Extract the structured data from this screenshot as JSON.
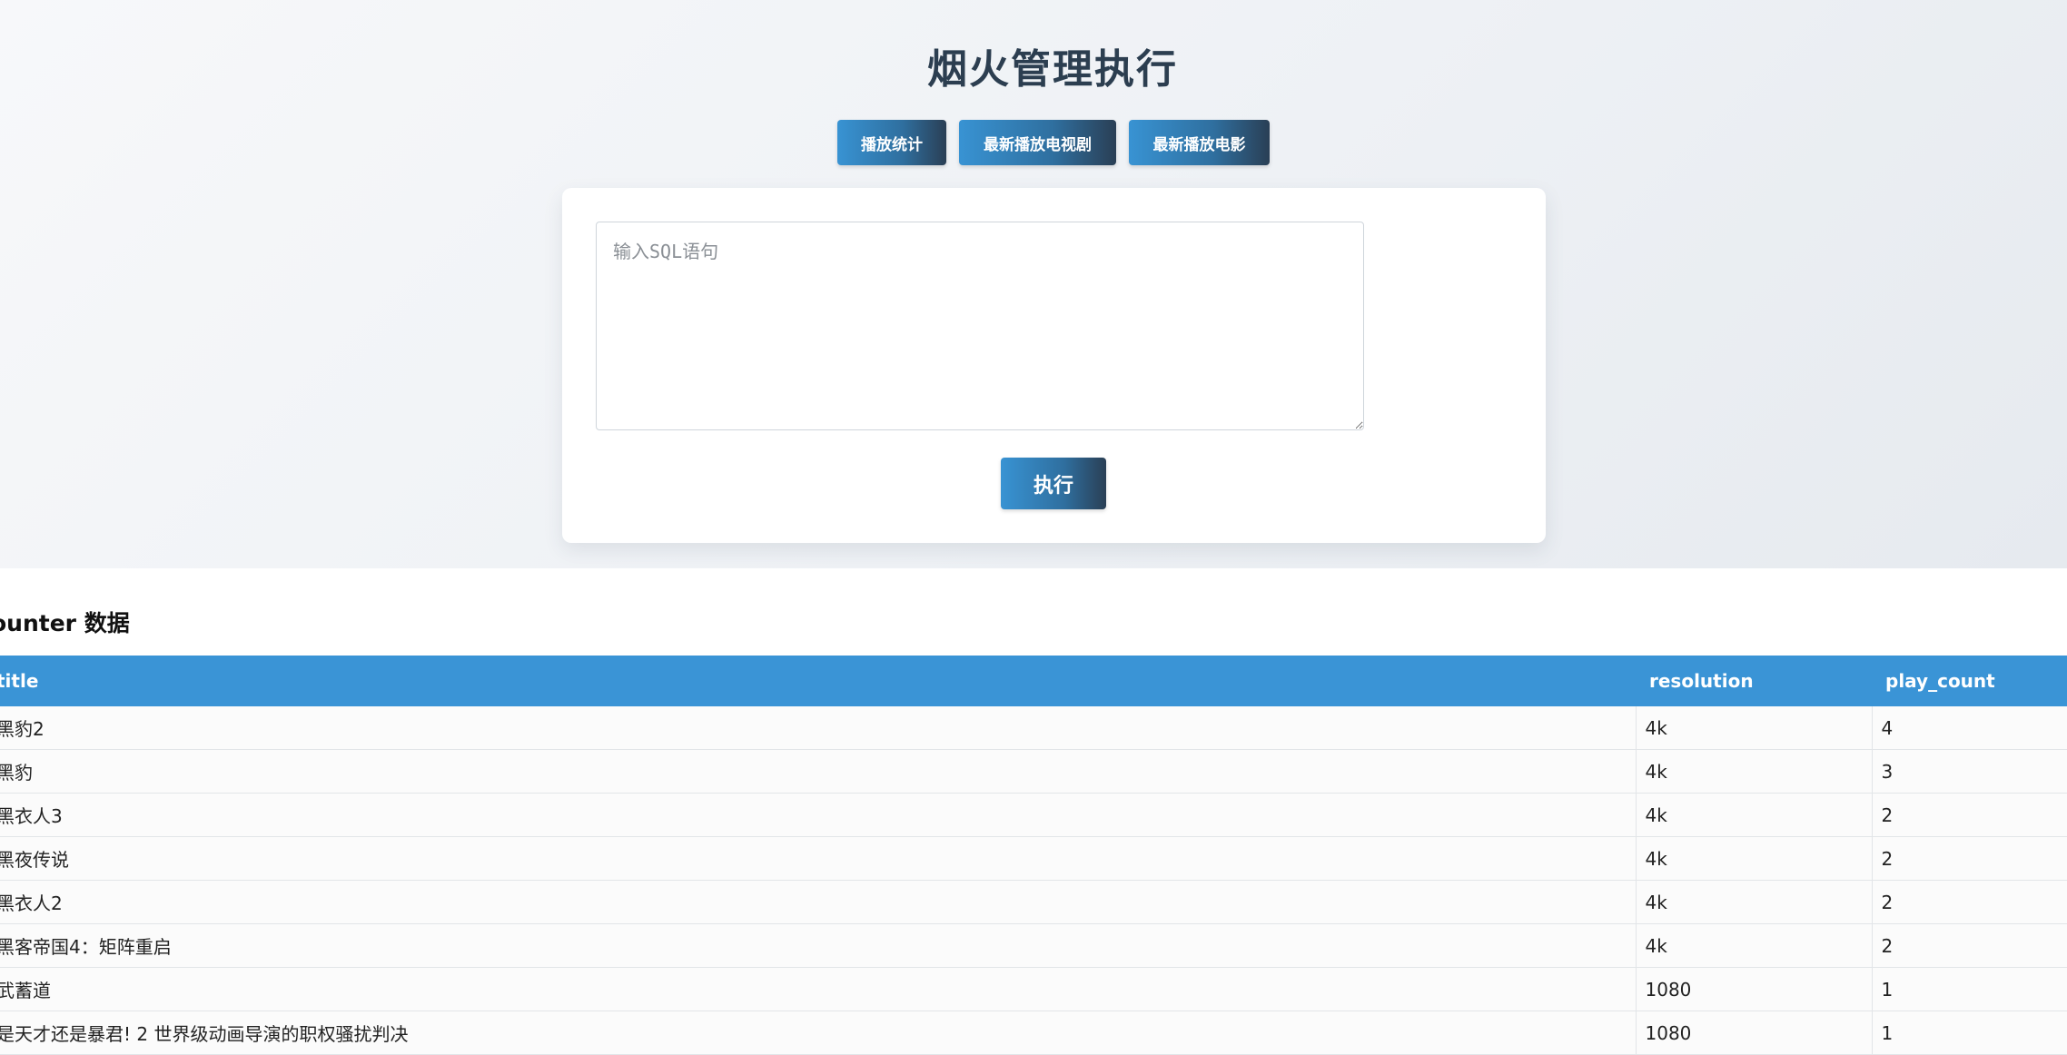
{
  "header": {
    "title": "烟火管理执行"
  },
  "nav": {
    "buttons": [
      {
        "label": "播放统计"
      },
      {
        "label": "最新播放电视剧"
      },
      {
        "label": "最新播放电影"
      }
    ]
  },
  "query": {
    "placeholder": "输入SQL语句",
    "value": "",
    "execute_label": "执行"
  },
  "section": {
    "title": "ounter 数据"
  },
  "table": {
    "columns": [
      "title",
      "resolution",
      "play_count"
    ],
    "rows": [
      {
        "title": "黑豹2",
        "resolution": "4k",
        "play_count": "4"
      },
      {
        "title": "黑豹",
        "resolution": "4k",
        "play_count": "3"
      },
      {
        "title": "黑衣人3",
        "resolution": "4k",
        "play_count": "2"
      },
      {
        "title": "黑夜传说",
        "resolution": "4k",
        "play_count": "2"
      },
      {
        "title": "黑衣人2",
        "resolution": "4k",
        "play_count": "2"
      },
      {
        "title": "黑客帝国4：矩阵重启",
        "resolution": "4k",
        "play_count": "2"
      },
      {
        "title": "武蓄道",
        "resolution": "1080",
        "play_count": "1"
      },
      {
        "title": "是天才还是暴君! 2 世界级动画导演的职权骚扰判决",
        "resolution": "1080",
        "play_count": "1"
      }
    ]
  }
}
